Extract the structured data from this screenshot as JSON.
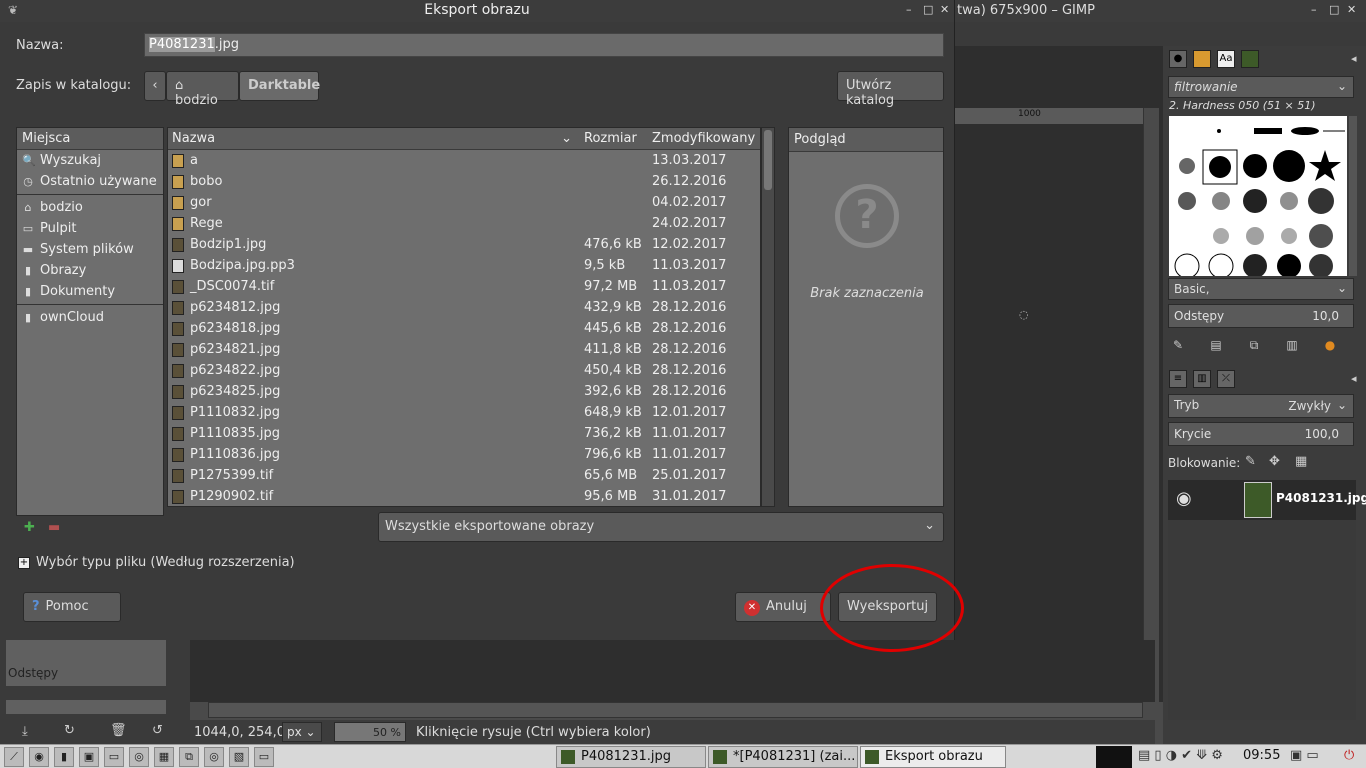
{
  "gimp": {
    "title": "twa) 675x900 – GIMP",
    "ruler_mark": "1000",
    "statusbar": {
      "coords": "1044,0, 254,0",
      "unit": "px",
      "zoom": "50 %",
      "message": "Kliknięcie rysuje (Ctrl wybiera kolor)"
    },
    "left_panel": {
      "spacing_label": "Odstępy"
    },
    "dock": {
      "brush_filter": "filtrowanie",
      "brush_name": "2. Hardness 050 (51 × 51)",
      "preset": "Basic,",
      "spacing_label": "Odstępy",
      "spacing_value": "10,0",
      "mode_label": "Tryb",
      "mode_value": "Zwykły",
      "opacity_label": "Krycie",
      "opacity_value": "100,0",
      "lock_label": "Blokowanie:",
      "layer_name": "P4081231.jpg",
      "dock_icon_text": "Aa"
    }
  },
  "dialog": {
    "title": "Eksport obrazu",
    "name_label": "Nazwa:",
    "name_value_selected": "P4081231",
    "name_value_ext": ".jpg",
    "folder_label": "Zapis w katalogu:",
    "path": [
      "bodzio",
      "Darktable"
    ],
    "create_folder": "Utwórz katalog",
    "places_header": "Miejsca",
    "places_group1": [
      {
        "icon": "search-icon",
        "glyph": "🔍",
        "label": "Wyszukaj"
      },
      {
        "icon": "recent-icon",
        "glyph": "◷",
        "label": "Ostatnio używane"
      }
    ],
    "places_group2": [
      {
        "icon": "home-icon",
        "glyph": "⌂",
        "label": "bodzio"
      },
      {
        "icon": "desktop-icon",
        "glyph": "▭",
        "label": "Pulpit"
      },
      {
        "icon": "drive-icon",
        "glyph": "▬",
        "label": "System plików"
      },
      {
        "icon": "folder-icon",
        "glyph": "▮",
        "label": "Obrazy"
      },
      {
        "icon": "folder-icon",
        "glyph": "▮",
        "label": "Dokumenty"
      }
    ],
    "places_group3": [
      {
        "icon": "folder-icon",
        "glyph": "▮",
        "label": "ownCloud"
      }
    ],
    "columns": {
      "name": "Nazwa",
      "size": "Rozmiar",
      "modified": "Zmodyfikowany"
    },
    "files": [
      {
        "type": "folder",
        "name": "a",
        "size": "",
        "date": "13.03.2017"
      },
      {
        "type": "folder",
        "name": "bobo",
        "size": "",
        "date": "26.12.2016"
      },
      {
        "type": "folder",
        "name": "gor",
        "size": "",
        "date": "04.02.2017"
      },
      {
        "type": "folder",
        "name": "Rege",
        "size": "",
        "date": "24.02.2017"
      },
      {
        "type": "img",
        "name": "Bodzip1.jpg",
        "size": "476,6 kB",
        "date": "12.02.2017"
      },
      {
        "type": "doc",
        "name": "Bodzipa.jpg.pp3",
        "size": "9,5 kB",
        "date": "11.03.2017"
      },
      {
        "type": "img",
        "name": "_DSC0074.tif",
        "size": "97,2 MB",
        "date": "11.03.2017"
      },
      {
        "type": "img",
        "name": "p6234812.jpg",
        "size": "432,9 kB",
        "date": "28.12.2016"
      },
      {
        "type": "img",
        "name": "p6234818.jpg",
        "size": "445,6 kB",
        "date": "28.12.2016"
      },
      {
        "type": "img",
        "name": "p6234821.jpg",
        "size": "411,8 kB",
        "date": "28.12.2016"
      },
      {
        "type": "img",
        "name": "p6234822.jpg",
        "size": "450,4 kB",
        "date": "28.12.2016"
      },
      {
        "type": "img",
        "name": "p6234825.jpg",
        "size": "392,6 kB",
        "date": "28.12.2016"
      },
      {
        "type": "img",
        "name": "P1110832.jpg",
        "size": "648,9 kB",
        "date": "12.01.2017"
      },
      {
        "type": "img",
        "name": "P1110835.jpg",
        "size": "736,2 kB",
        "date": "11.01.2017"
      },
      {
        "type": "img",
        "name": "P1110836.jpg",
        "size": "796,6 kB",
        "date": "11.01.2017"
      },
      {
        "type": "img",
        "name": "P1275399.tif",
        "size": "65,6 MB",
        "date": "25.01.2017"
      },
      {
        "type": "img",
        "name": "P1290902.tif",
        "size": "95,6 MB",
        "date": "31.01.2017"
      }
    ],
    "preview_header": "Podgląd",
    "preview_empty": "Brak zaznaczenia",
    "filter_value": "Wszystkie eksportowane obrazy",
    "filetype_label": "Wybór typu pliku (Według rozszerzenia)",
    "help_button": "Pomoc",
    "cancel_button": "Anuluj",
    "export_button": "Wyeksportuj"
  },
  "taskbar": {
    "tasks": [
      "P4081231.jpg",
      "*[P4081231] (zai...",
      "Eksport obrazu"
    ],
    "clock": "09:55"
  },
  "colors": {
    "annotation": "#e00000",
    "dialog_bg": "#3a3a3a",
    "list_bg": "#6e6e6e"
  }
}
